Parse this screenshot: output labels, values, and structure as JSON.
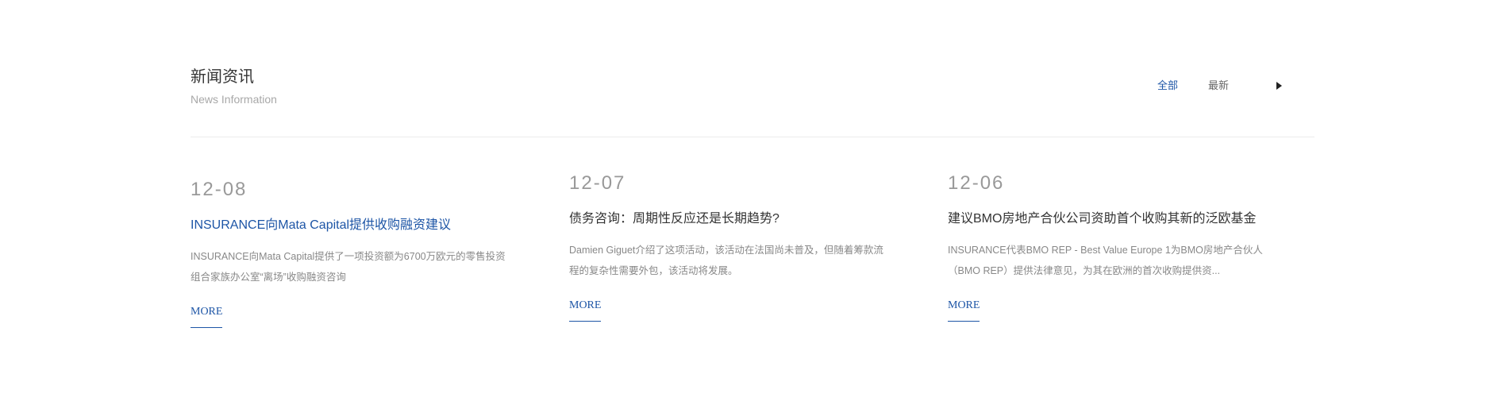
{
  "section": {
    "title_zh": "新闻资讯",
    "title_en": "News Information"
  },
  "tabs": [
    {
      "label": "全部"
    },
    {
      "label": "最新"
    }
  ],
  "news": [
    {
      "date": "12-08",
      "title": "INSURANCE向Mata Capital提供收购融资建议",
      "description": "INSURANCE向Mata Capital提供了一项投资额为6700万欧元的零售投资组合家族办公室“离场”收购融资咨询",
      "more": "MORE"
    },
    {
      "date": "12-07",
      "title": "债务咨询：周期性反应还是长期趋势?",
      "description": "Damien Giguet介绍了这项活动，该活动在法国尚未普及，但随着筹款流程的复杂性需要外包，该活动将发展。",
      "more": "MORE"
    },
    {
      "date": "12-06",
      "title": "建议BMO房地产合伙公司资助首个收购其新的泛欧基金",
      "description": "INSURANCE代表BMO REP - Best Value Europe 1为BMO房地产合伙人（BMO REP）提供法律意见，为其在欧洲的首次收购提供资...",
      "more": "MORE"
    }
  ],
  "colors": {
    "accent": "#1d55a6",
    "text": "#333333",
    "muted": "#888888",
    "date": "#999999",
    "divider": "#ececec"
  }
}
